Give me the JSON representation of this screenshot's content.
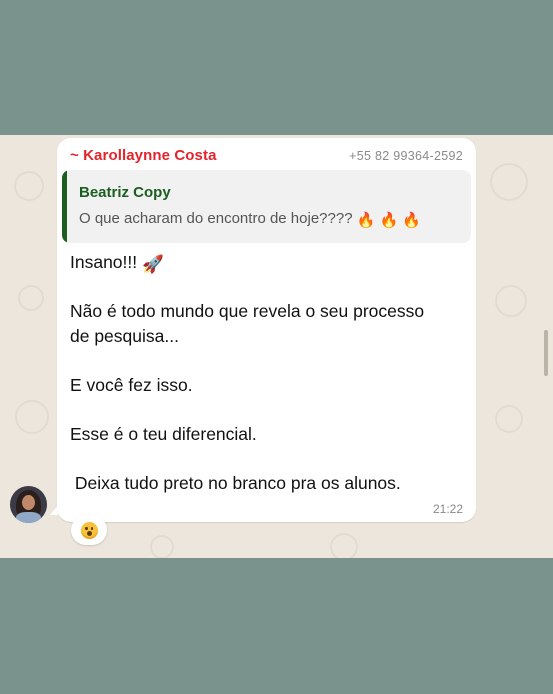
{
  "message": {
    "sender_name": "~ Karollaynne Costa",
    "sender_phone": "+55 82 99364-2592",
    "quoted": {
      "author": "Beatriz Copy",
      "text": "O que acharam do encontro de hoje????"
    },
    "lines": [
      "Insano!!!",
      "Não é todo mundo que revela o seu processo",
      "de pesquisa...",
      "E você fez isso.",
      "Esse é o teu diferencial.",
      " Deixa tudo preto no branco pra os alunos."
    ],
    "time": "21:22"
  },
  "reaction": {
    "icon": "astonished-face-icon"
  },
  "colors": {
    "sender_name": "#e3242b",
    "quote_accent": "#1b5e20",
    "chat_background": "#ece6dc",
    "outer_background": "#7a938c"
  }
}
